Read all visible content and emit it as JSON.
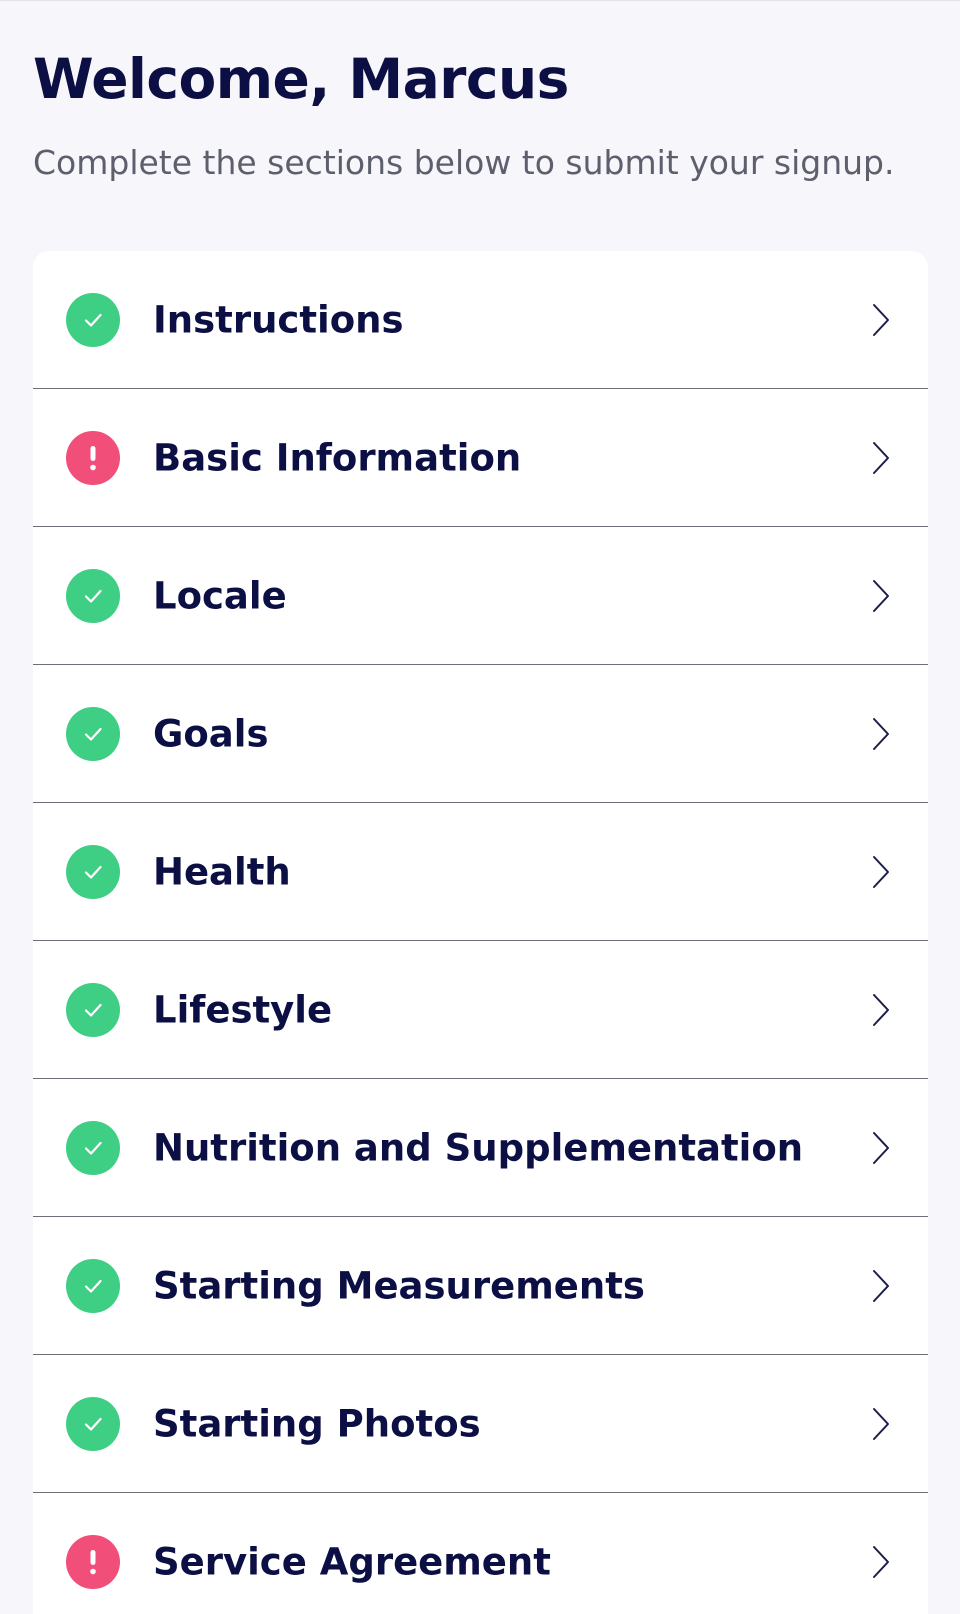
{
  "header": {
    "title": "Welcome, Marcus",
    "subtitle": "Complete the sections below to submit your signup."
  },
  "colors": {
    "complete": "#3ecf84",
    "incomplete": "#f24e7a",
    "text_primary": "#0c0f43",
    "text_secondary": "#5d5f6d"
  },
  "sections": [
    {
      "label": "Instructions",
      "status": "complete",
      "icon": "check-icon"
    },
    {
      "label": "Basic Information",
      "status": "incomplete",
      "icon": "exclamation-icon"
    },
    {
      "label": "Locale",
      "status": "complete",
      "icon": "check-icon"
    },
    {
      "label": "Goals",
      "status": "complete",
      "icon": "check-icon"
    },
    {
      "label": "Health",
      "status": "complete",
      "icon": "check-icon"
    },
    {
      "label": "Lifestyle",
      "status": "complete",
      "icon": "check-icon"
    },
    {
      "label": "Nutrition and Supplementation",
      "status": "complete",
      "icon": "check-icon"
    },
    {
      "label": "Starting Measurements",
      "status": "complete",
      "icon": "check-icon"
    },
    {
      "label": "Starting Photos",
      "status": "complete",
      "icon": "check-icon"
    },
    {
      "label": "Service Agreement",
      "status": "incomplete",
      "icon": "exclamation-icon"
    }
  ]
}
